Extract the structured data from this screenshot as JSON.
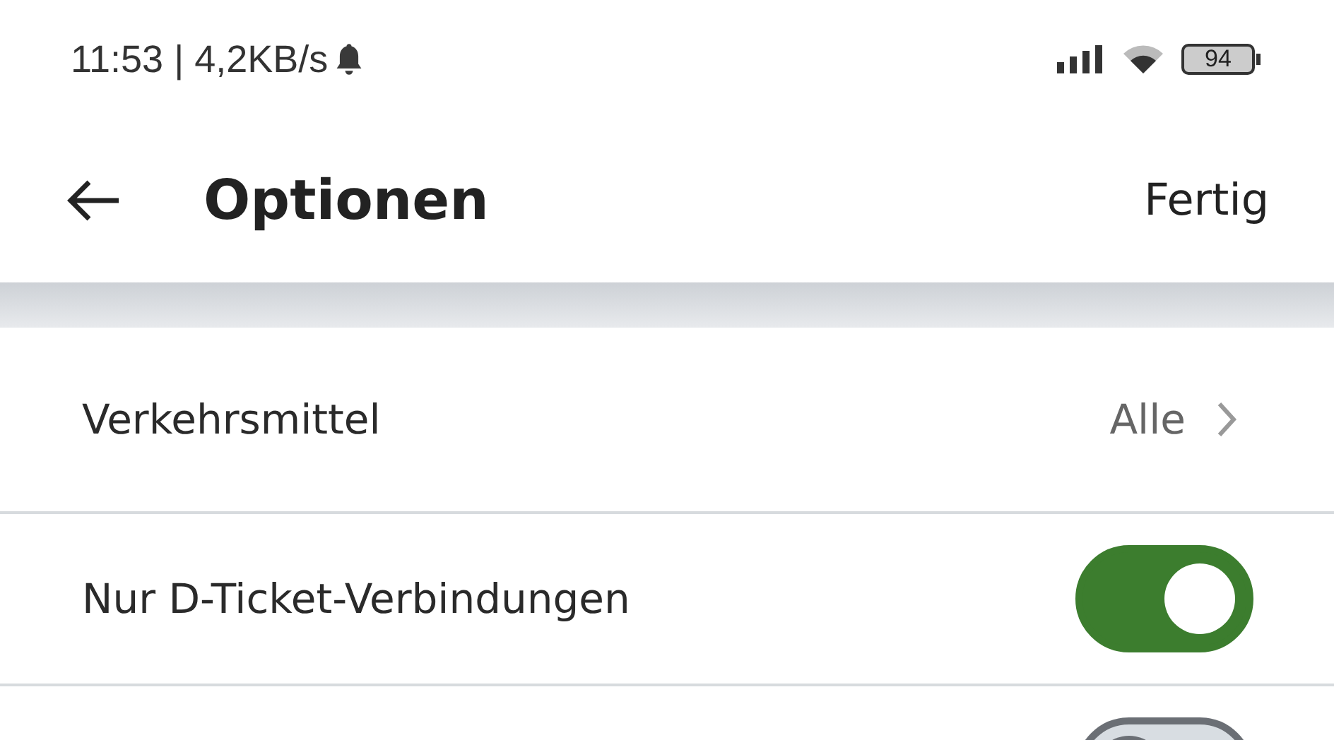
{
  "status_bar": {
    "time": "11:53 | 4,2KB/s",
    "battery": "94"
  },
  "header": {
    "title": "Optionen",
    "action": "Fertig"
  },
  "rows": [
    {
      "kind": "link",
      "label": "Verkehrsmittel",
      "value": "Alle"
    },
    {
      "kind": "toggle",
      "label": "Nur D-Ticket-Verbindungen",
      "on": true
    },
    {
      "kind": "toggle",
      "on": false
    }
  ]
}
